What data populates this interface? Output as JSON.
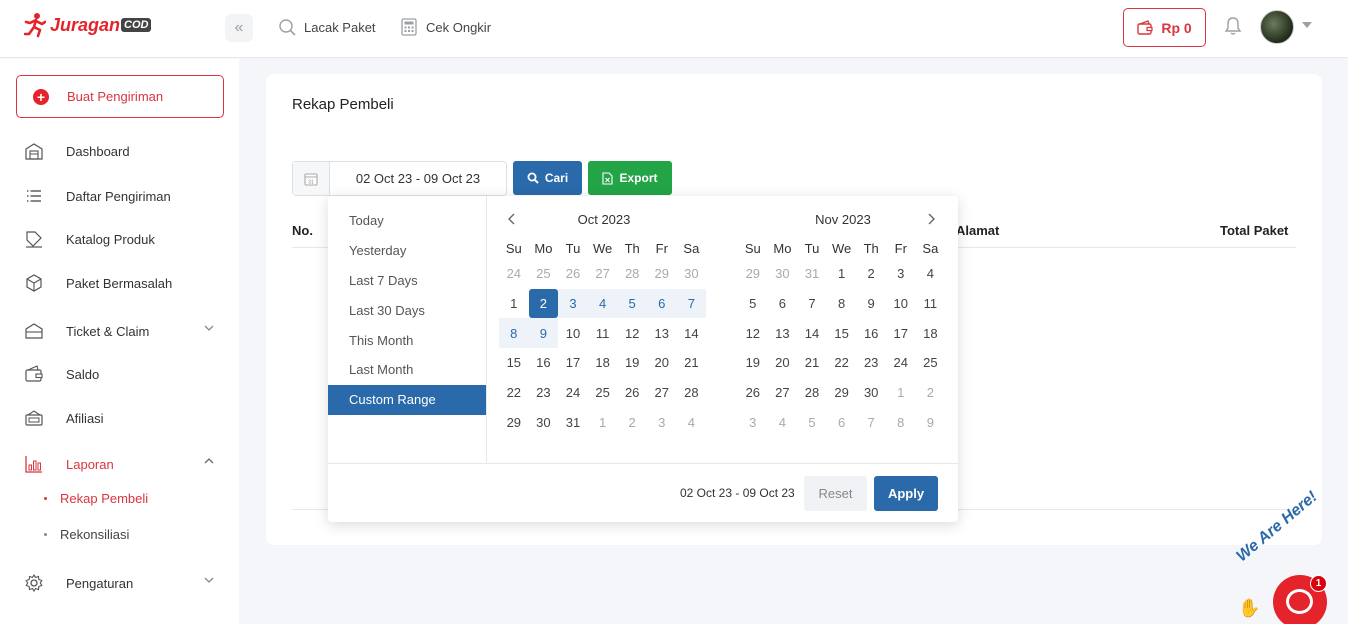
{
  "header": {
    "logo_text": "Juragan",
    "logo_badge": "COD",
    "collapse_icon": "«",
    "links": [
      {
        "label": "Lacak Paket",
        "icon": "search-package-icon"
      },
      {
        "label": "Cek Ongkir",
        "icon": "calculator-icon"
      }
    ],
    "balance": "Rp 0"
  },
  "sidebar": {
    "new_shipment": "Buat Pengiriman",
    "items": [
      {
        "label": "Dashboard"
      },
      {
        "label": "Daftar Pengiriman"
      },
      {
        "label": "Katalog Produk"
      },
      {
        "label": "Paket Bermasalah"
      },
      {
        "label": "Ticket & Claim"
      },
      {
        "label": "Saldo"
      },
      {
        "label": "Afiliasi"
      },
      {
        "label": "Laporan"
      },
      {
        "label": "Pengaturan"
      }
    ],
    "sub_items": [
      {
        "label": "Rekap Pembeli"
      },
      {
        "label": "Rekonsiliasi"
      }
    ]
  },
  "main": {
    "title": "Rekap Pembeli",
    "date_range_value": "02 Oct 23 - 09 Oct 23",
    "search_button": "Cari",
    "export_button": "Export",
    "table_headers": {
      "no": "No.",
      "alamat": "Alamat",
      "total_paket": "Total Paket"
    }
  },
  "picker": {
    "ranges": [
      "Today",
      "Yesterday",
      "Last 7 Days",
      "Last 30 Days",
      "This Month",
      "Last Month",
      "Custom Range"
    ],
    "active_range": "Custom Range",
    "weekdays": [
      "Su",
      "Mo",
      "Tu",
      "We",
      "Th",
      "Fr",
      "Sa"
    ],
    "left_month": {
      "title": "Oct 2023",
      "weeks": [
        [
          "24",
          "25",
          "26",
          "27",
          "28",
          "29",
          "30"
        ],
        [
          "1",
          "2",
          "3",
          "4",
          "5",
          "6",
          "7"
        ],
        [
          "8",
          "9",
          "10",
          "11",
          "12",
          "13",
          "14"
        ],
        [
          "15",
          "16",
          "17",
          "18",
          "19",
          "20",
          "21"
        ],
        [
          "22",
          "23",
          "24",
          "25",
          "26",
          "27",
          "28"
        ],
        [
          "29",
          "30",
          "31",
          "1",
          "2",
          "3",
          "4"
        ]
      ]
    },
    "right_month": {
      "title": "Nov 2023",
      "weeks": [
        [
          "29",
          "30",
          "31",
          "1",
          "2",
          "3",
          "4"
        ],
        [
          "5",
          "6",
          "7",
          "8",
          "9",
          "10",
          "11"
        ],
        [
          "12",
          "13",
          "14",
          "15",
          "16",
          "17",
          "18"
        ],
        [
          "19",
          "20",
          "21",
          "22",
          "23",
          "24",
          "25"
        ],
        [
          "26",
          "27",
          "28",
          "29",
          "30",
          "1",
          "2"
        ],
        [
          "3",
          "4",
          "5",
          "6",
          "7",
          "8",
          "9"
        ]
      ]
    },
    "selected_start": "2 Oct 2023",
    "selected_end": "9 Oct 2023",
    "footer_range": "02 Oct 23 - 09 Oct 23",
    "reset_button": "Reset",
    "apply_button": "Apply"
  },
  "chat_widget": {
    "tagline": "We Are Here!",
    "badge_count": "1"
  },
  "colors": {
    "brand_red": "#e4232b",
    "primary_blue": "#2a6aaa",
    "export_green": "#22a447"
  }
}
